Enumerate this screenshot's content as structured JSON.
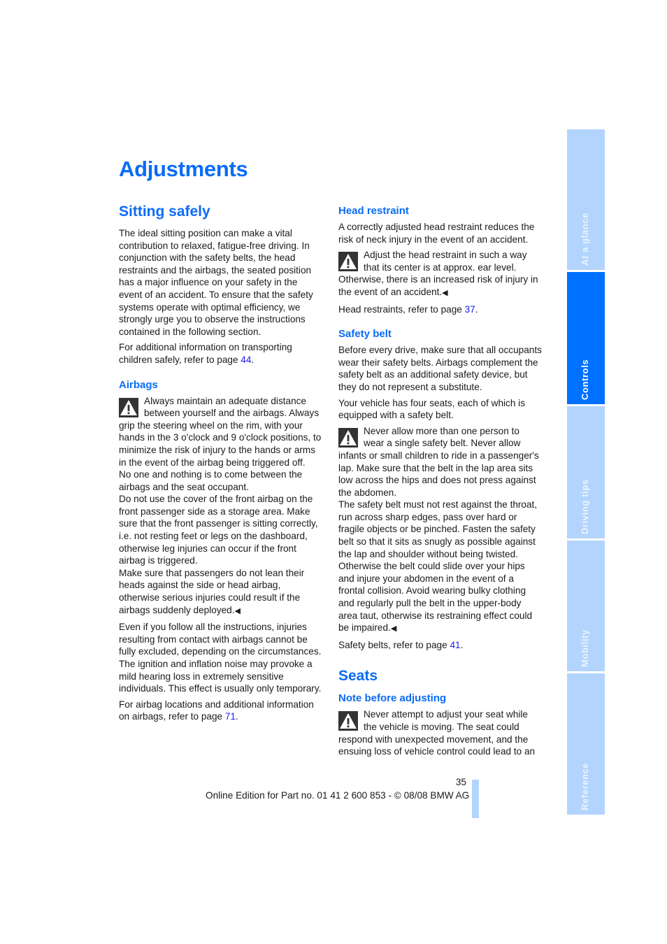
{
  "page": {
    "title": "Adjustments",
    "page_number": "35",
    "footer": "Online Edition for Part no. 01 41 2 600 853 - © 08/08 BMW AG"
  },
  "sidebar": {
    "tabs": [
      {
        "label": "At a glance",
        "active": false
      },
      {
        "label": "Controls",
        "active": true
      },
      {
        "label": "Driving tips",
        "active": false
      },
      {
        "label": "Mobility",
        "active": false
      },
      {
        "label": "Reference",
        "active": false
      }
    ]
  },
  "colors": {
    "accent": "#0a6cf5",
    "link": "#1b1bf0",
    "tab_active": "#0070ff",
    "tab_inactive": "#b3d4fc"
  },
  "icons": {
    "warning": "warning-triangle-icon",
    "end_marker": "◀"
  },
  "left": {
    "sitting_safely": {
      "heading": "Sitting safely",
      "p1": "The ideal sitting position can make a vital contribution to relaxed, fatigue-free driving. In conjunction with the safety belts, the head restraints and the airbags, the seated position has a major influence on your safety in the event of an accident. To ensure that the safety systems operate with optimal efficiency, we strongly urge you to observe the instructions contained in the following section.",
      "p2_prefix": "For additional information on transporting children safely, refer to page ",
      "p2_link": "44",
      "p2_suffix": "."
    },
    "airbags": {
      "heading": "Airbags",
      "warn_p1": "Always maintain an adequate distance between yourself and the airbags. Always grip the steering wheel on the rim, with your hands in the 3 o'clock and 9 o'clock positions, to minimize the risk of injury to the hands or arms in the event of the airbag being triggered off.",
      "warn_p2": "No one and nothing is to come between the airbags and the seat occupant.",
      "warn_p3": "Do not use the cover of the front airbag on the front passenger side as a storage area. Make sure that the front passenger is sitting correctly, i.e. not resting feet or legs on the dashboard, otherwise leg injuries can occur if the front airbag is triggered.",
      "warn_p4": "Make sure that passengers do not lean their heads against the side or head airbag, otherwise serious injuries could result if the airbags suddenly deployed.",
      "p_even": "Even if you follow all the instructions, injuries resulting from contact with airbags cannot be fully excluded, depending on the circumstances. The ignition and inflation noise may provoke a mild hearing loss in extremely sensitive individuals. This effect is usually only temporary.",
      "ref_prefix": "For airbag locations and additional information on airbags, refer to page ",
      "ref_link": "71",
      "ref_suffix": "."
    }
  },
  "right": {
    "head_restraint": {
      "heading": "Head restraint",
      "p1": "A correctly adjusted head restraint reduces the risk of neck injury in the event of an accident.",
      "warn": "Adjust the head restraint in such a way that its center is at approx. ear level. Otherwise, there is an increased risk of injury in the event of an accident.",
      "ref_prefix": "Head restraints, refer to page ",
      "ref_link": "37",
      "ref_suffix": "."
    },
    "safety_belt": {
      "heading": "Safety belt",
      "p1": "Before every drive, make sure that all occupants wear their safety belts. Airbags complement the safety belt as an additional safety device, but they do not represent a substitute.",
      "p2": "Your vehicle has four seats, each of which is equipped with a safety belt.",
      "warn_p1": "Never allow more than one person to wear a single safety belt. Never allow infants or small children to ride in a passenger's lap. Make sure that the belt in the lap area sits low across the hips and does not press against the abdomen.",
      "warn_p2": "The safety belt must not rest against the throat, run across sharp edges, pass over hard or fragile objects or be pinched. Fasten the safety belt so that it sits as snugly as possible against the lap and shoulder without being twisted. Otherwise the belt could slide over your hips and injure your abdomen in the event of a frontal collision. Avoid wearing bulky clothing and regularly pull the belt in the upper-body area taut, otherwise its restraining effect could be impaired.",
      "ref_prefix": "Safety belts, refer to page ",
      "ref_link": "41",
      "ref_suffix": "."
    },
    "seats": {
      "heading": "Seats",
      "sub_heading": "Note before adjusting",
      "warn": "Never attempt to adjust your seat while the vehicle is moving. The seat could respond with unexpected movement, and the ensuing loss of vehicle control could lead to an"
    }
  }
}
